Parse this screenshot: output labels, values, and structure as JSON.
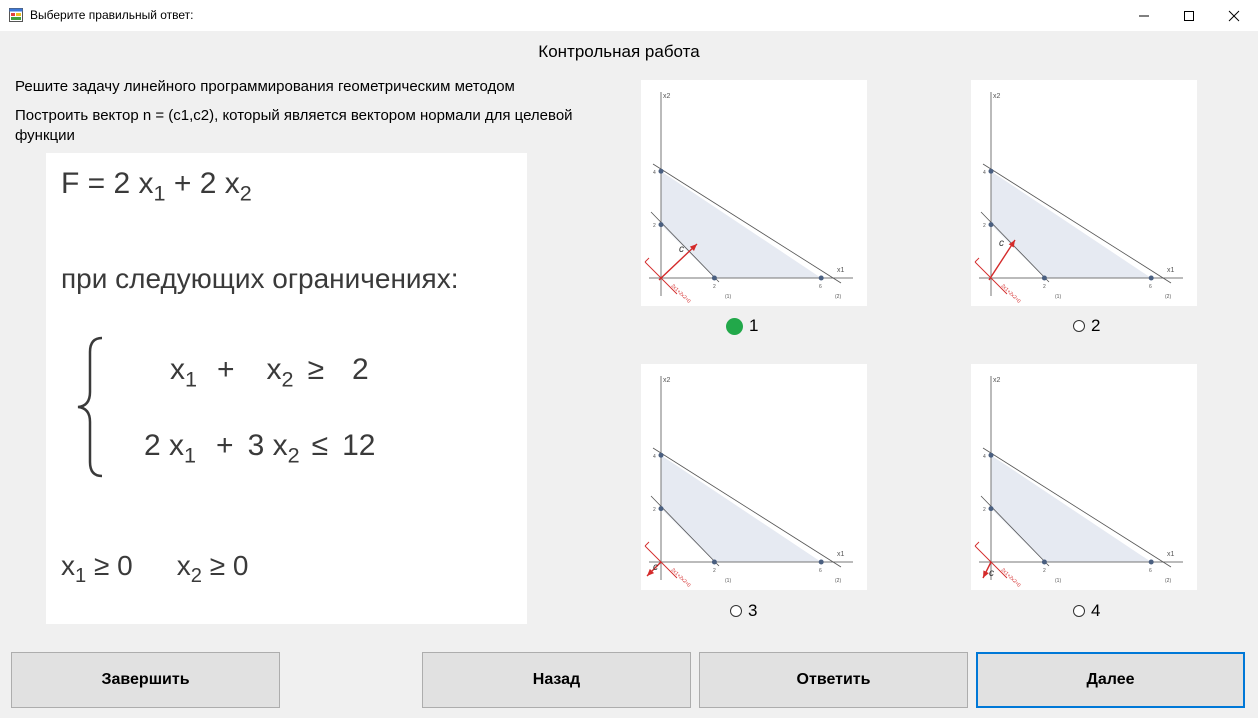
{
  "window": {
    "title": "Выберите правильный ответ:",
    "icon": "app-form-icon"
  },
  "heading": "Контрольная работа",
  "task": {
    "line1": "Решите задачу линейного программирования геометрическим методом",
    "line2": "Построить вектор n = (c1,c2), который является вектором нормали для целевой функции"
  },
  "formula": {
    "objective": {
      "lhs": "F = 2 x",
      "s1": "1",
      "mid": " + 2 x",
      "s2": "2"
    },
    "constraints_title": "при следующих ограничениях:",
    "c1": {
      "a": "x",
      "as": "1",
      "op": "+",
      "b": "x",
      "bs": "2",
      "rel": "≥",
      "rhs": "2"
    },
    "c2": {
      "a": "2 x",
      "as": "1",
      "op": "+",
      "b": "3 x",
      "bs": "2",
      "rel": "≤",
      "rhs": "12"
    },
    "nonneg": {
      "a": "x",
      "as": "1",
      "ar": " ≥ 0",
      "b": "x",
      "bs": "2",
      "br": " ≥ 0"
    }
  },
  "graph_labels": {
    "x1": "x1",
    "x2": "x2",
    "y4": "4",
    "y2": "2",
    "xa": "2",
    "xb": "6",
    "l1": "(1)",
    "l2": "(2)",
    "c": "c",
    "line": "2x1+2x2=0"
  },
  "options": [
    {
      "label": "1",
      "selected": true,
      "vector": "up-right"
    },
    {
      "label": "2",
      "selected": false,
      "vector": "up"
    },
    {
      "label": "3",
      "selected": false,
      "vector": "down-left"
    },
    {
      "label": "4",
      "selected": false,
      "vector": "down"
    }
  ],
  "buttons": {
    "finish": "Завершить",
    "back": "Назад",
    "answer": "Ответить",
    "next": "Далее"
  },
  "colors": {
    "selected_radio": "#22a84a",
    "vector": "#d42a2a",
    "feasible_region": "#e6eaf2",
    "focus_border": "#0078d7"
  }
}
